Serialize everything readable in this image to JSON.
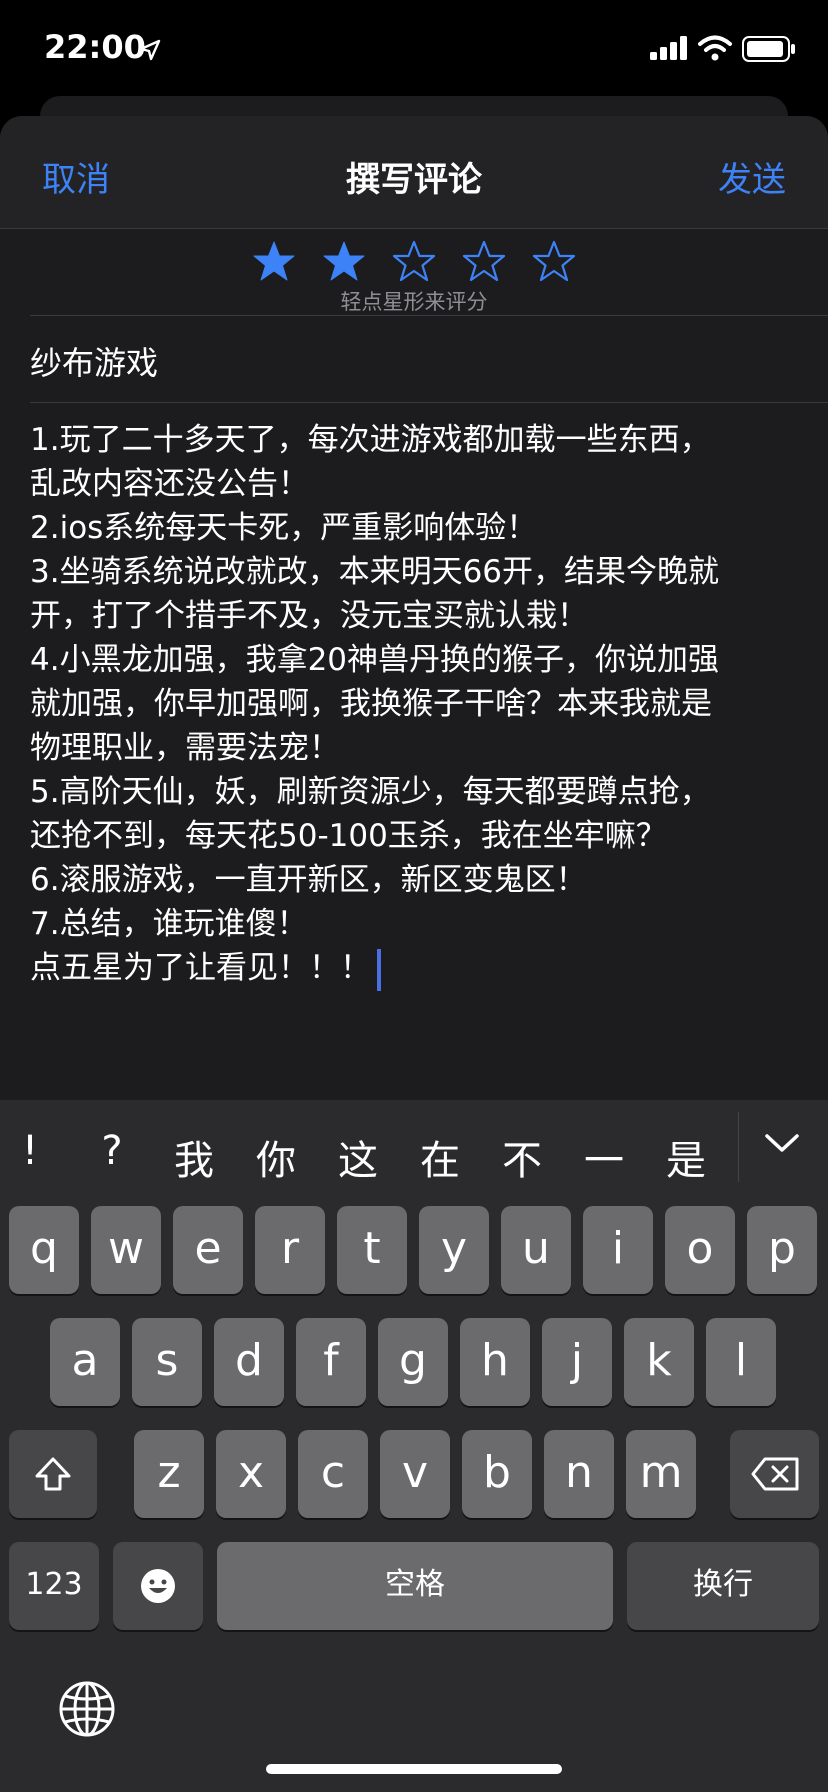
{
  "status_bar": {
    "time": "22:00",
    "icons": [
      "location-arrow-icon",
      "signal-bars-icon",
      "wifi-icon",
      "battery-icon"
    ]
  },
  "nav": {
    "cancel_label": "取消",
    "title": "撰写评论",
    "send_label": "发送",
    "accent_color": "#3d82f6"
  },
  "rating": {
    "value": 2,
    "max": 5,
    "hint": "轻点星形来评分"
  },
  "review": {
    "title": "纱布游戏",
    "body_lines": [
      "1.玩了二十多天了，每次进游戏都加载一些东西，",
      "乱改内容还没公告！",
      "2.ios系统每天卡死，严重影响体验！",
      "3.坐骑系统说改就改，本来明天66开，结果今晚就",
      "开，打了个措手不及，没元宝买就认栽！",
      "4.小黑龙加强，我拿20神兽丹换的猴子，你说加强",
      "就加强，你早加强啊，我换猴子干啥？本来我就是",
      "物理职业，需要法宠！",
      "5.高阶天仙，妖，刷新资源少，每天都要蹲点抢，",
      "还抢不到，每天花50-100玉杀，我在坐牢嘛？",
      "6.滚服游戏，一直开新区，新区变鬼区！",
      "7.总结，谁玩谁傻！",
      "点五星为了让看见！！！"
    ]
  },
  "keyboard": {
    "candidates": [
      "!",
      "?",
      "我",
      "你",
      "这",
      "在",
      "不",
      "一",
      "是"
    ],
    "row1": [
      "q",
      "w",
      "e",
      "r",
      "t",
      "y",
      "u",
      "i",
      "o",
      "p"
    ],
    "row2": [
      "a",
      "s",
      "d",
      "f",
      "g",
      "h",
      "j",
      "k",
      "l"
    ],
    "row3": [
      "z",
      "x",
      "c",
      "v",
      "b",
      "n",
      "m"
    ],
    "numbers_label": "123",
    "space_label": "空格",
    "return_label": "换行"
  }
}
